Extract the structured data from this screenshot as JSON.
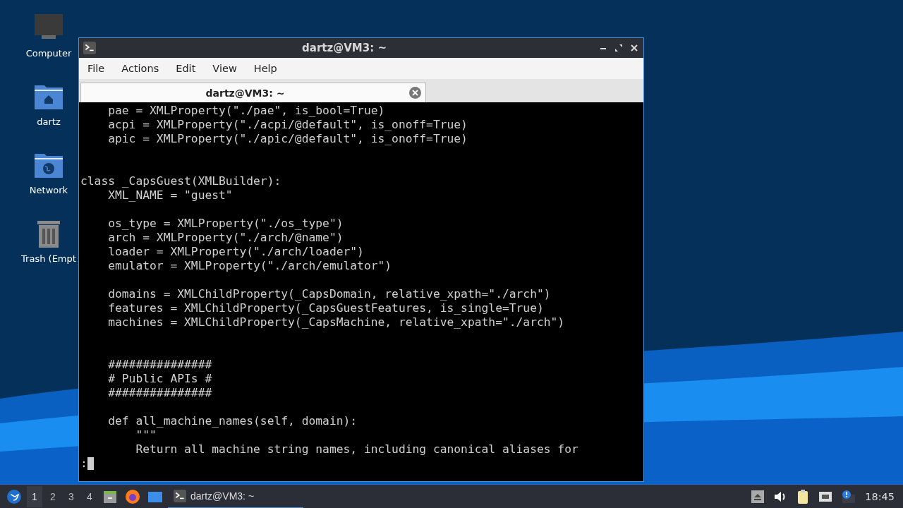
{
  "desktop_icons": [
    {
      "kind": "computer",
      "label": "Computer"
    },
    {
      "kind": "home",
      "label": "dartz"
    },
    {
      "kind": "network",
      "label": "Network"
    },
    {
      "kind": "trash",
      "label": "Trash (Empt"
    }
  ],
  "window": {
    "title": "dartz@VM3: ~",
    "menu": [
      "File",
      "Actions",
      "Edit",
      "View",
      "Help"
    ],
    "tabs": [
      {
        "label": "dartz@VM3: ~",
        "selected": true
      }
    ]
  },
  "terminal": {
    "lines": [
      {
        "kind": "code",
        "text": "    pae = XMLProperty(\"./pae\", is_bool=True)"
      },
      {
        "kind": "code",
        "text": "    acpi = XMLProperty(\"./acpi/@default\", is_onoff=True)"
      },
      {
        "kind": "code",
        "text": "    apic = XMLProperty(\"./apic/@default\", is_onoff=True)"
      },
      {
        "kind": "blank"
      },
      {
        "kind": "blank"
      },
      {
        "kind": "code",
        "text": "class _CapsGuest(XMLBuilder):"
      },
      {
        "kind": "code",
        "text": "    XML_NAME = \"guest\""
      },
      {
        "kind": "blank"
      },
      {
        "kind": "code",
        "text": "    os_type = XMLProperty(\"./os_type\")"
      },
      {
        "kind": "code",
        "text": "    arch = XMLProperty(\"./arch/@name\")"
      },
      {
        "kind": "code",
        "text": "    loader = XMLProperty(\"./arch/loader\")"
      },
      {
        "kind": "code",
        "text": "    emulator = XMLProperty(\"./arch/emulator\")"
      },
      {
        "kind": "blank"
      },
      {
        "kind": "code",
        "text": "    domains = XMLChildProperty(_CapsDomain, relative_xpath=\"./arch\")"
      },
      {
        "kind": "code",
        "text": "    features = XMLChildProperty(_CapsGuestFeatures, is_single=True)"
      },
      {
        "kind": "code",
        "text": "    machines = XMLChildProperty(_CapsMachine, relative_xpath=\"./arch\")"
      },
      {
        "kind": "blank"
      },
      {
        "kind": "blank"
      },
      {
        "kind": "code",
        "text": "    ###############"
      },
      {
        "kind": "code",
        "text": "    # Public APIs #"
      },
      {
        "kind": "code",
        "text": "    ###############"
      },
      {
        "kind": "blank"
      },
      {
        "kind": "code",
        "text": "    def all_machine_names(self, domain):"
      },
      {
        "kind": "code",
        "text": "        \"\"\""
      },
      {
        "kind": "code",
        "text": "        Return all machine string names, including canonical aliases for"
      }
    ],
    "prompt": ":"
  },
  "taskbar": {
    "workspaces": [
      {
        "label": "1",
        "selected": true
      },
      {
        "label": "2",
        "selected": false
      },
      {
        "label": "3",
        "selected": false
      },
      {
        "label": "4",
        "selected": false
      }
    ],
    "tasks": [
      {
        "label": "dartz@VM3: ~",
        "selected": true
      }
    ],
    "clock": "18:45"
  }
}
